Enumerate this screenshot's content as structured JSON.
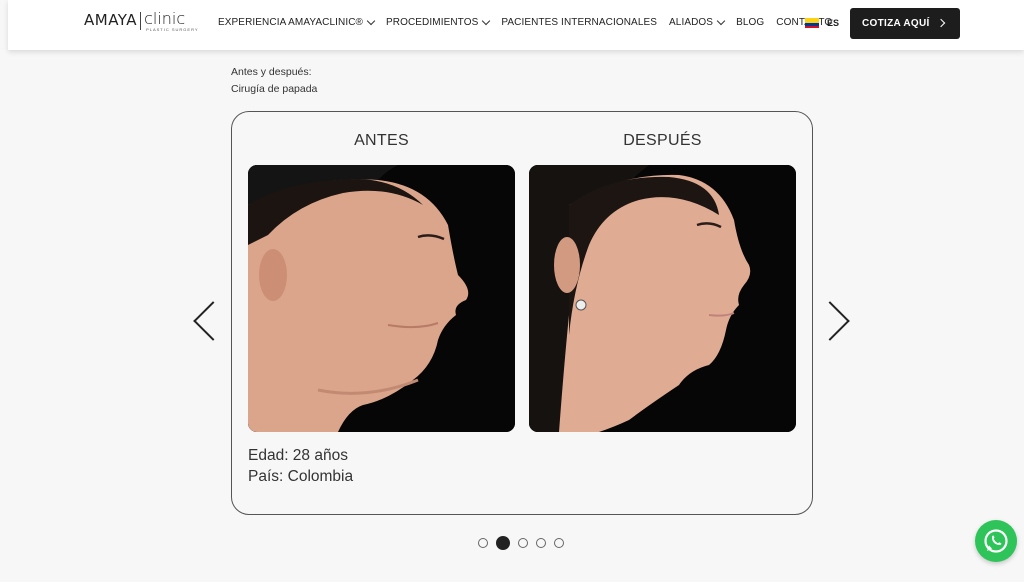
{
  "header": {
    "logo": {
      "brand": "AMAYA",
      "clinic": "clinic",
      "subtitle": "PLASTIC SURGERY"
    },
    "nav": [
      {
        "label": "EXPERIENCIA AMAYACLINIC®",
        "has_dropdown": true
      },
      {
        "label": "PROCEDIMIENTOS",
        "has_dropdown": true
      },
      {
        "label": "PACIENTES INTERNACIONALES",
        "has_dropdown": false
      },
      {
        "label": "ALIADOS",
        "has_dropdown": true
      },
      {
        "label": "BLOG",
        "has_dropdown": false
      },
      {
        "label": "CONTACTO",
        "has_dropdown": false
      }
    ],
    "language": {
      "code": "ES",
      "flag": "colombia-flag"
    },
    "cta_label": "COTIZA AQUÍ"
  },
  "caption": {
    "line1": "Antes y después:",
    "line2": "Cirugía de papada"
  },
  "comparison": {
    "before_label": "ANTES",
    "after_label": "DESPUÉS",
    "before_image": "profile-photo-before",
    "after_image": "profile-photo-after",
    "age": "Edad: 28 años",
    "country": "País: Colombia"
  },
  "carousel": {
    "slide_count": 5,
    "active_index": 1
  },
  "colors": {
    "accent": "#1d1d1d",
    "whatsapp": "#2ec45a",
    "photo_bg": "#060606"
  }
}
